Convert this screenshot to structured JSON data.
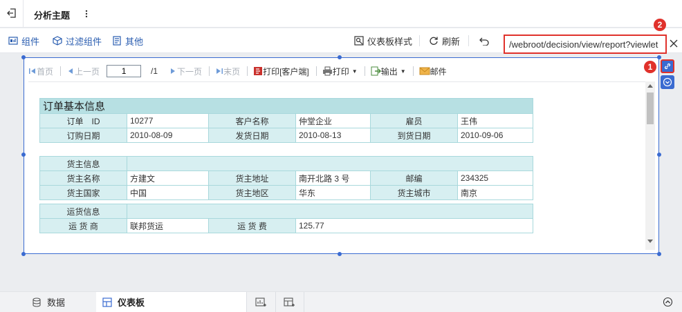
{
  "header": {
    "title": "分析主题"
  },
  "toolbar": {
    "component": "组件",
    "filter_component": "过滤组件",
    "other": "其他",
    "dashboard_style": "仪表板样式",
    "refresh": "刷新",
    "url_value": "/webroot/decision/view/report?viewlet"
  },
  "badges": {
    "one": "1",
    "two": "2"
  },
  "report_toolbar": {
    "first": "首页",
    "prev": "上一页",
    "page_value": "1",
    "page_total": "/1",
    "next": "下一页",
    "last": "末页",
    "print_client": "打印[客户端]",
    "print": "打印",
    "export": "输出",
    "email": "邮件"
  },
  "order": {
    "header": "订单基本信息",
    "row1": {
      "label_a": "订单　ID",
      "value_a": "10277",
      "label_b": "客户名称",
      "value_b": "仲堂企业",
      "label_c": "雇员",
      "value_c": "王伟"
    },
    "row2": {
      "label_a": "订购日期",
      "value_a": "2010-08-09",
      "label_b": "发货日期",
      "value_b": "2010-08-13",
      "label_c": "到货日期",
      "value_c": "2010-09-06"
    }
  },
  "shipper": {
    "section": "货主信息",
    "row1": {
      "label_a": "货主名称",
      "value_a": "方建文",
      "label_b": "货主地址",
      "value_b": "南开北路 3 号",
      "label_c": "邮编",
      "value_c": "234325"
    },
    "row2": {
      "label_a": "货主国家",
      "value_a": "中国",
      "label_b": "货主地区",
      "value_b": "华东",
      "label_c": "货主城市",
      "value_c": "南京"
    }
  },
  "freight": {
    "section": "运货信息",
    "row1": {
      "label_a": "运 货 商",
      "value_a": "联邦货运",
      "label_b": "运 货 费",
      "value_b": "125.77"
    }
  },
  "bottom_tabs": {
    "data": "数据",
    "dashboard": "仪表板"
  },
  "colors": {
    "accent": "#3a6bd1",
    "highlight": "#e0312b",
    "table_header": "#b7e0e3",
    "table_label": "#d7eff1"
  }
}
